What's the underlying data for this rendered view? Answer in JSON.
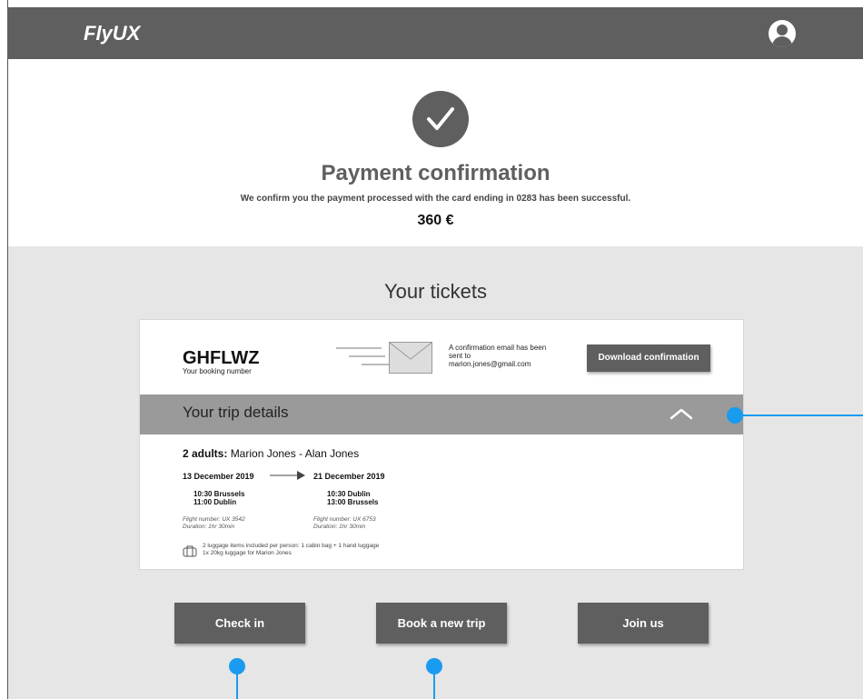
{
  "header": {
    "logo": "FlyUX",
    "avatar_icon": "user-avatar-icon"
  },
  "confirmation": {
    "icon": "checkmark-icon",
    "title": "Payment confirmation",
    "message": "We confirm you the payment processed with the card ending in 0283 has been successful.",
    "amount": "360 €"
  },
  "tickets": {
    "title": "Your tickets",
    "booking_code": "GHFLWZ",
    "booking_label": "Your booking number",
    "email_icon": "envelope-icon",
    "email_text": "A confirmation email has been sent to marion.jones@gmail.com",
    "download_label": "Download confirmation",
    "trip_details_title": "Your trip details",
    "collapse_icon": "chevron-up-icon",
    "passengers_label": "2 adults:",
    "passengers_names": "Marion Jones - Alan Jones",
    "outbound": {
      "date": "13 December 2019",
      "depart": "10:30 Brussels",
      "arrive": "11:00 Dublin",
      "flight": "Flight number: UX 3542",
      "duration": "Duration: 1hr 30min"
    },
    "return": {
      "date": "21 December 2019",
      "depart": "10:30 Dublin",
      "arrive": "13:00 Brussels",
      "flight": "Flight number: UX 6753",
      "duration": "Duration: 1hr 30min"
    },
    "luggage_icon": "luggage-icon",
    "luggage_line1": "2 luggage items included per person: 1 cabin bag + 1 hand luggage",
    "luggage_line2": "1x 20kg luggage for Marion Jones"
  },
  "actions": {
    "check_in": "Check in",
    "book_new": "Book a new trip",
    "join": "Join us"
  },
  "colors": {
    "header_bg": "#5f5f5f",
    "section_bg": "#e6e6e6",
    "trip_bar_bg": "#9a9a9a",
    "button_bg": "#5f5f5f",
    "annotation": "#1a9bf0"
  }
}
